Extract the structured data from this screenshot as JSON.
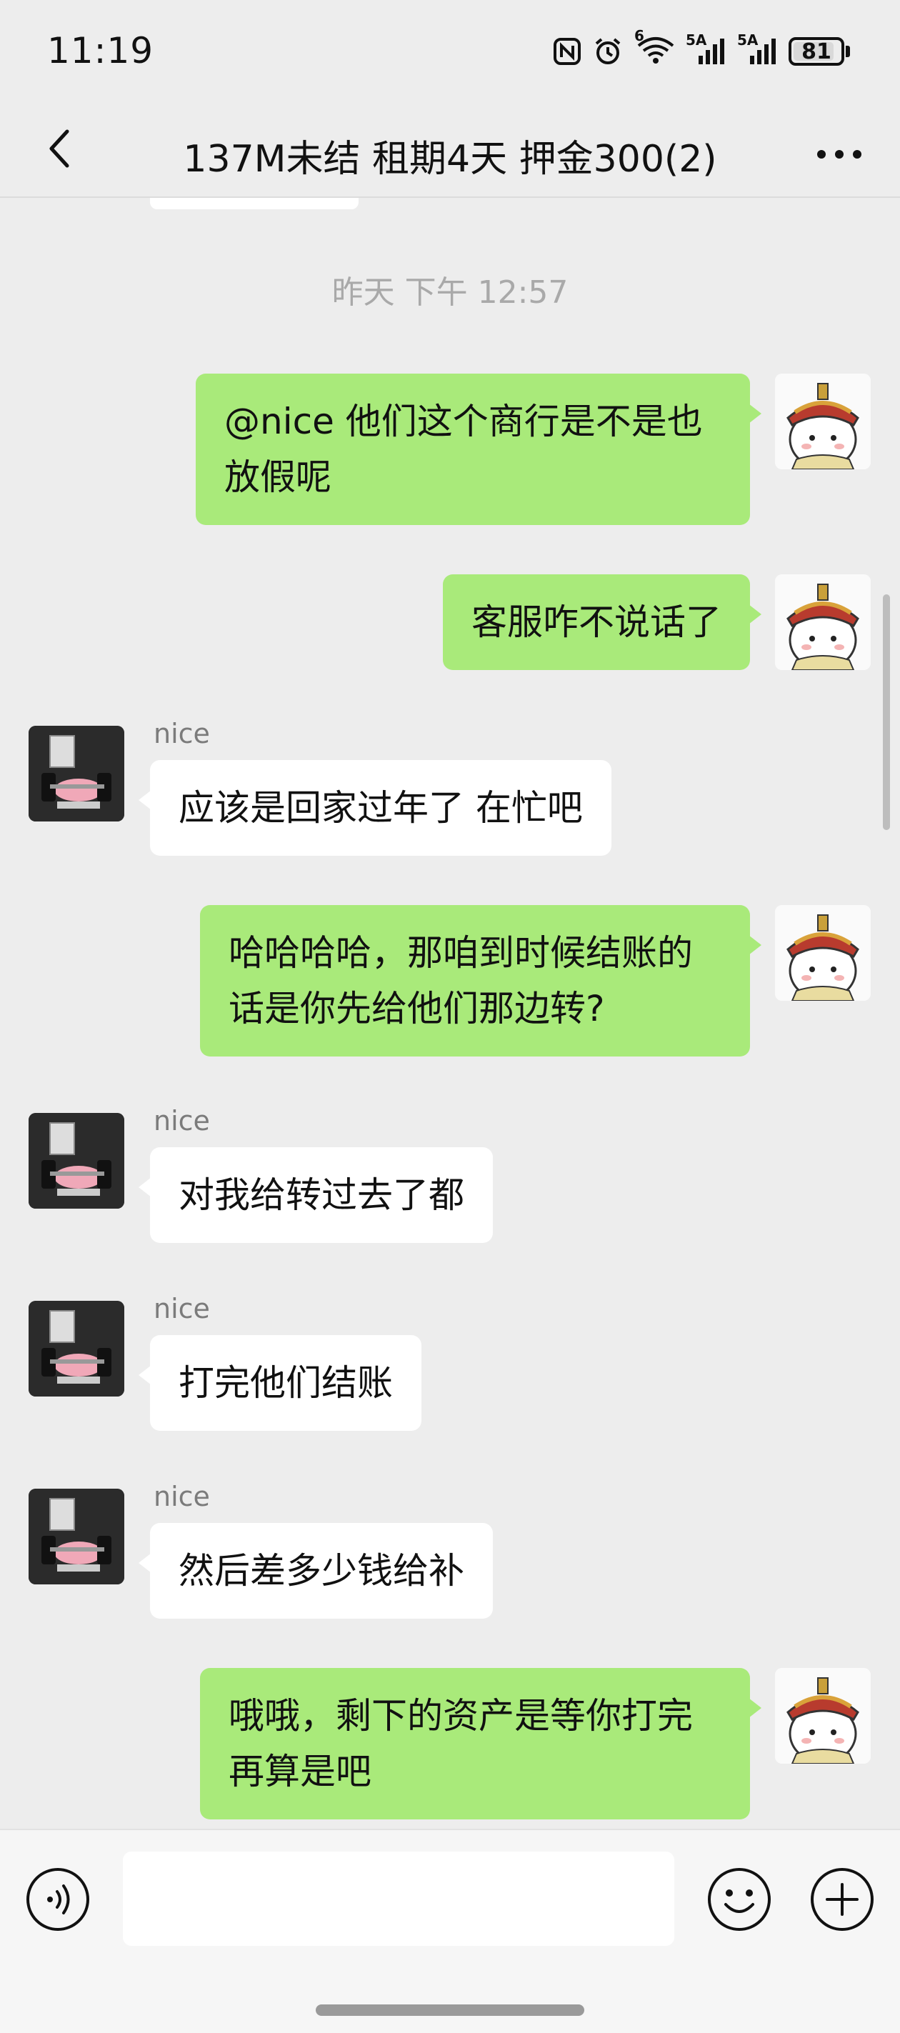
{
  "status_bar": {
    "time": "11:19",
    "icons": [
      "nfc-icon",
      "alarm-icon",
      "wifi-icon",
      "signal-5a-icon",
      "signal-5a-icon"
    ],
    "wifi_label": "6",
    "signal1_label": "5A",
    "signal2_label": "5A",
    "battery_level": "81"
  },
  "header": {
    "title": "137M未结 租期4天 押金300(2)"
  },
  "chat": {
    "time_divider": "昨天 下午 12:57",
    "messages": [
      {
        "side": "self",
        "text": "@nice 他们这个商行是不是也放假呢"
      },
      {
        "side": "self",
        "text": "客服咋不说话了"
      },
      {
        "side": "other",
        "sender": "nice",
        "text": "应该是回家过年了  在忙吧"
      },
      {
        "side": "self",
        "text": "哈哈哈哈，那咱到时候结账的话是你先给他们那边转?"
      },
      {
        "side": "other",
        "sender": "nice",
        "text": "对我给转过去了都"
      },
      {
        "side": "other",
        "sender": "nice",
        "text": "打完他们结账"
      },
      {
        "side": "other",
        "sender": "nice",
        "text": "然后差多少钱给补"
      },
      {
        "side": "self",
        "text": "哦哦，剩下的资产是等你打完再算是吧"
      }
    ]
  },
  "input_bar": {
    "placeholder": "",
    "value": ""
  },
  "colors": {
    "background": "#ededed",
    "self_bubble": "#a9ea7a",
    "other_bubble": "#ffffff",
    "timestamp": "#a9a9a9"
  }
}
